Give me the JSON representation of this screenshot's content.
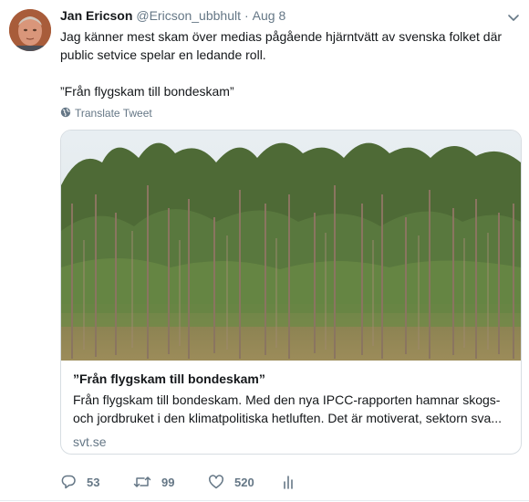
{
  "tweet": {
    "author_name": "Jan Ericson",
    "author_handle": "@Ericson_ubbhult",
    "separator": "·",
    "date": "Aug 8",
    "text_line1": "Jag känner mest skam över medias pågående hjärntvätt av svenska folket där",
    "text_line2": "public setvice spelar en ledande roll.",
    "quote": "”Från flygskam till bondeskam”",
    "translate_label": "Translate Tweet"
  },
  "card": {
    "title": "”Från flygskam till bondeskam”",
    "description": "Från flygskam till bondeskam. Med den nya IPCC-rapporten hamnar skogs- och jordbruket i den klimatpolitiska hetluften. Det är motiverat, sektorn sva...",
    "domain": "svt.se"
  },
  "actions": {
    "replies": "53",
    "retweets": "99",
    "likes": "520"
  },
  "icons": {
    "avatar": "person-avatar",
    "caret": "chevron-down-icon",
    "translate": "globe-icon",
    "reply": "reply-icon",
    "retweet": "retweet-icon",
    "like": "heart-icon",
    "analytics": "analytics-icon"
  },
  "colors": {
    "text": "#14171a",
    "secondary": "#657786",
    "border": "#d7dde2"
  }
}
